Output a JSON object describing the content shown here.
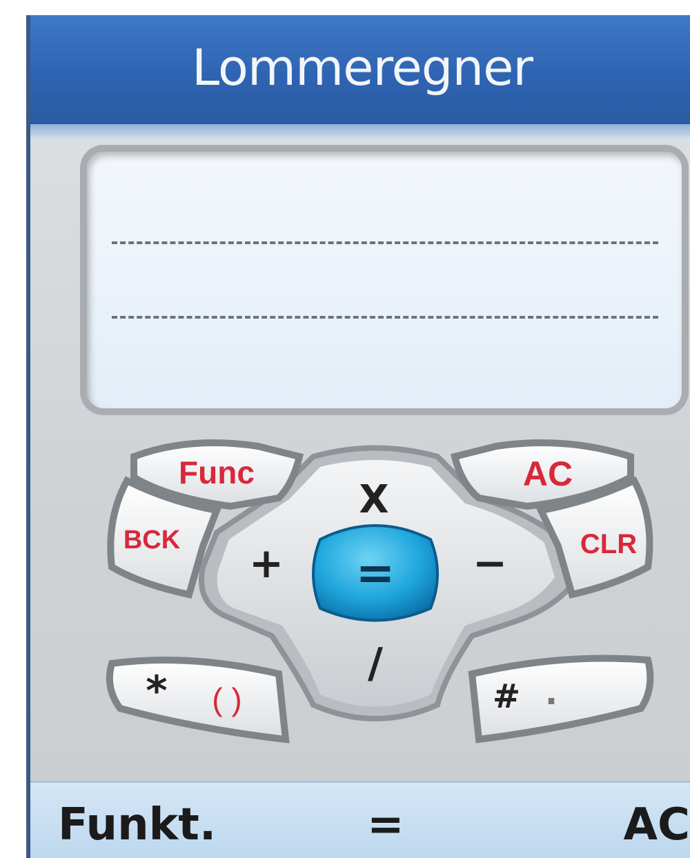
{
  "title": "Lommeregner",
  "display": {
    "expression": "",
    "result": ""
  },
  "keys": {
    "func": "Func",
    "ac": "AC",
    "bck": "BCK",
    "clr": "CLR",
    "multiply": "X",
    "plus": "+",
    "minus": "−",
    "equals": "=",
    "divide": "/",
    "star": "*",
    "parens": "( )",
    "hash": "#",
    "dot": "."
  },
  "softkeys": {
    "left": "Funkt.",
    "center": "=",
    "right": "AC"
  },
  "colors": {
    "title_bar": "#2f64b2",
    "key_red_label": "#d8283a",
    "equals_key": "#1e9fd6",
    "bottom_bar": "#c8dff2"
  }
}
